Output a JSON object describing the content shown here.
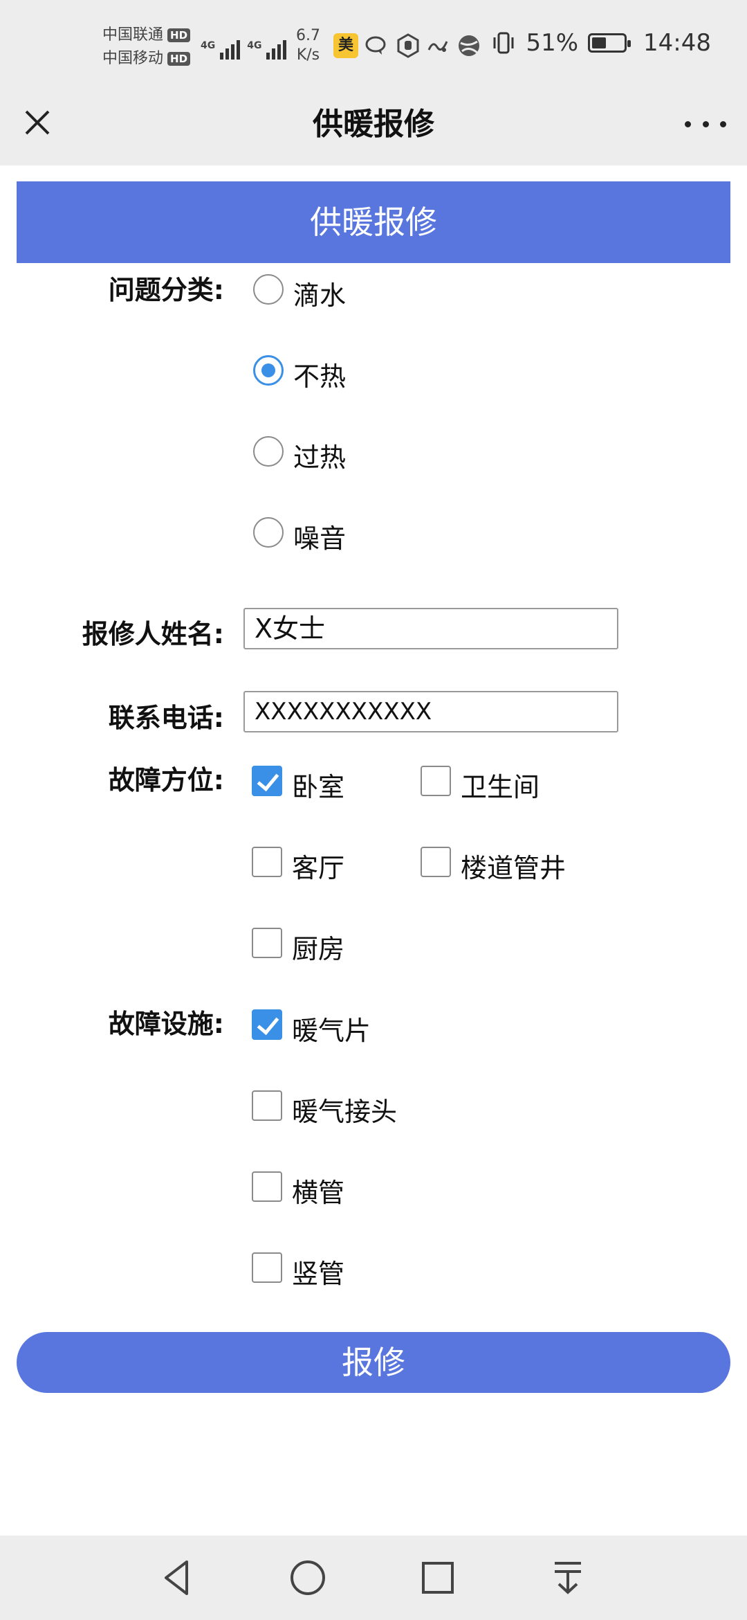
{
  "status_bar": {
    "carrier_1": "中国联通",
    "carrier_2": "中国移动",
    "hd_badge": "HD",
    "network_type": "4G",
    "speed_value": "6.7",
    "speed_unit": "K/s",
    "app_badge": "美",
    "battery_percent": "51%",
    "battery_level": 0.51,
    "time": "14:48"
  },
  "titlebar": {
    "title": "供暖报修",
    "close_icon": "close-icon",
    "more_icon": "more-icon"
  },
  "banner": {
    "title": "供暖报修"
  },
  "form": {
    "problem_category": {
      "label": "问题分类:",
      "options": [
        {
          "label": "滴水",
          "selected": false
        },
        {
          "label": "不热",
          "selected": true
        },
        {
          "label": "过热",
          "selected": false
        },
        {
          "label": "噪音",
          "selected": false
        }
      ]
    },
    "reporter_name": {
      "label": "报修人姓名:",
      "value": "X女士"
    },
    "phone": {
      "label": "联系电话:",
      "value": "XXXXXXXXXXX"
    },
    "fault_location": {
      "label": "故障方位:",
      "options": [
        {
          "label": "卧室",
          "checked": true
        },
        {
          "label": "卫生间",
          "checked": false
        },
        {
          "label": "客厅",
          "checked": false
        },
        {
          "label": "楼道管井",
          "checked": false
        },
        {
          "label": "厨房",
          "checked": false
        }
      ]
    },
    "fault_facility": {
      "label": "故障设施:",
      "options": [
        {
          "label": "暖气片",
          "checked": true
        },
        {
          "label": "暖气接头",
          "checked": false
        },
        {
          "label": "横管",
          "checked": false
        },
        {
          "label": "竖管",
          "checked": false
        }
      ]
    },
    "submit_label": "报修"
  },
  "navbar": {
    "back_icon": "back-triangle-icon",
    "home_icon": "home-circle-icon",
    "recents_icon": "recents-square-icon",
    "notifications_icon": "pull-down-icon"
  },
  "colors": {
    "accent": "#5876dd",
    "radio_checkbox_on": "#3a8fe6",
    "chrome_bg": "#ededed"
  }
}
